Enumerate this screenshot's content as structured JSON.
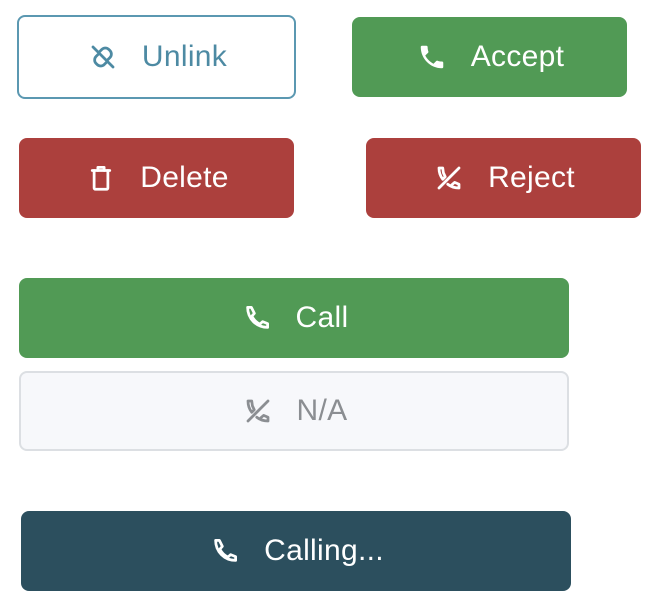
{
  "buttons": {
    "unlink": {
      "label": "Unlink",
      "icon": "unlink-icon"
    },
    "accept": {
      "label": "Accept",
      "icon": "phone-icon"
    },
    "delete": {
      "label": "Delete",
      "icon": "trash-icon"
    },
    "reject": {
      "label": "Reject",
      "icon": "phone-off-icon"
    },
    "call": {
      "label": "Call",
      "icon": "phone-icon"
    },
    "na": {
      "label": "N/A",
      "icon": "phone-off-icon"
    },
    "calling": {
      "label": "Calling...",
      "icon": "phone-icon"
    }
  },
  "colors": {
    "success": "#519a55",
    "danger": "#ac403d",
    "dark": "#2c4f5e",
    "outline": "#5b98b1",
    "disabled_bg": "#f7f8fb",
    "disabled_text": "#8b8e92"
  }
}
